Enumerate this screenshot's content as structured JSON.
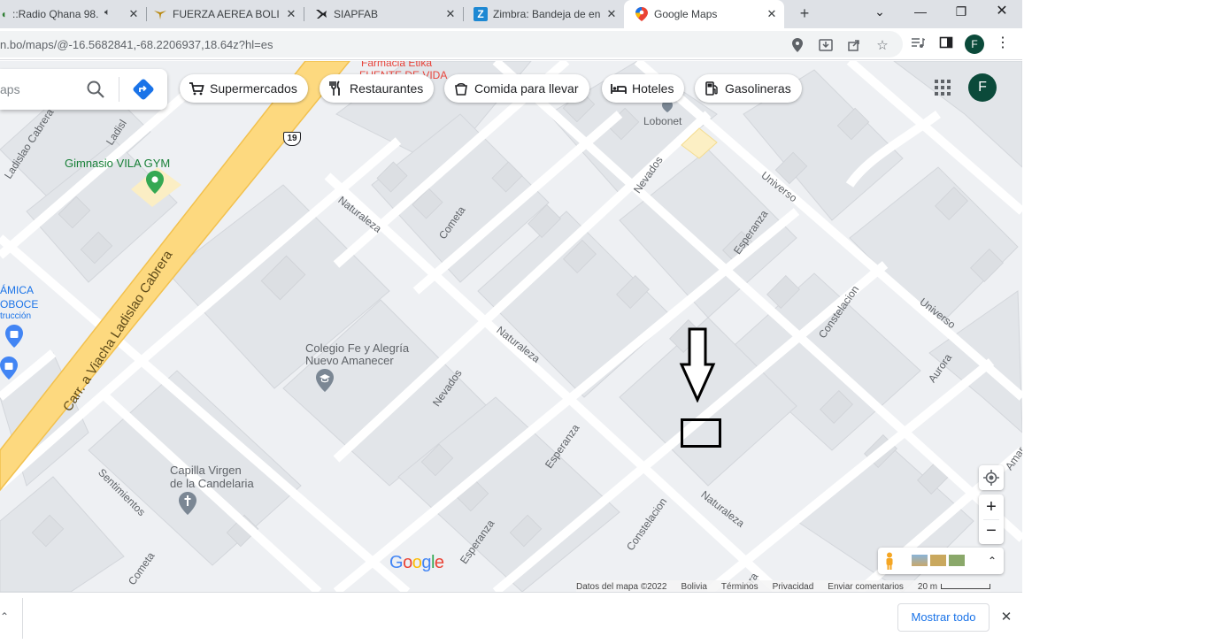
{
  "tabs": [
    {
      "title": "::Radio Qhana 98.",
      "icon": "radio-favicon",
      "audio": true
    },
    {
      "title": "FUERZA AEREA BOLIV",
      "icon": "fab-wings-favicon"
    },
    {
      "title": "SIAPFAB",
      "icon": "jet-favicon"
    },
    {
      "title": "Zimbra: Bandeja de en",
      "icon": "zimbra-favicon"
    },
    {
      "title": "Google Maps",
      "icon": "google-maps-favicon",
      "active": true
    }
  ],
  "address_bar": {
    "url": "n.bo/maps/@-16.5682841,-68.2206937,18.64z?hl=es"
  },
  "profile_initial": "F",
  "search": {
    "placeholder": "aps"
  },
  "chips": [
    {
      "label": "Supermercados",
      "icon": "cart-icon"
    },
    {
      "label": "Restaurantes",
      "icon": "fork-knife-icon"
    },
    {
      "label": "Comida para llevar",
      "icon": "takeout-icon"
    },
    {
      "label": "Hoteles",
      "icon": "bed-icon"
    },
    {
      "label": "Gasolineras",
      "icon": "fuel-icon"
    }
  ],
  "map_labels": {
    "farmacia_1": "Farmacia Etika",
    "farmacia_2": "FUENTE DE VIDA",
    "lobonet": "Lobonet",
    "gimnasio": "Gimnasio VILA GYM",
    "route_badge": "19",
    "carr_viacha": "Carr. a Viacha Ladislao Cabrera",
    "ladislao_cabrera": "Ladislao Cabrera",
    "ladis": "Ladisl",
    "naturaleza_1": "Naturaleza",
    "naturaleza_2": "Naturaleza",
    "naturaleza_3": "Naturaleza",
    "cometa_1": "Cometa",
    "cometa_2": "Cometa",
    "nevados_1": "Nevados",
    "nevados_2": "Nevados",
    "esperanza_1": "Esperanza",
    "esperanza_2": "Esperanza",
    "esperanza_3": "Esperanza",
    "universo_1": "Universo",
    "universo_2": "Universo",
    "constelacion_1": "Constelacion",
    "constelacion_2": "Constelacion",
    "aurora_1": "Aurora",
    "aurora_2": "ora",
    "amar": "Amar",
    "sentimientos": "Sentimientos",
    "colegio_1": "Colegio Fe y Alegría",
    "colegio_2": "Nuevo Amanecer",
    "capilla_1": "Capilla Virgen",
    "capilla_2": "de la Candelaria",
    "ceramica_1": "ÁMICA",
    "ceramica_2": "OBOCE",
    "ceramica_3": "trucción"
  },
  "map_footer": {
    "google": "Google",
    "datos": "Datos del mapa ©2022",
    "pais": "Bolivia",
    "terminos": "Términos",
    "privacidad": "Privacidad",
    "comentarios": "Enviar comentarios",
    "escala": "20 m"
  },
  "download_bar": {
    "show_all": "Mostrar todo"
  },
  "colors": {
    "highway": "#fdd97f",
    "block": "#e8eaed",
    "road": "#ffffff",
    "accent": "#1a73e8"
  }
}
